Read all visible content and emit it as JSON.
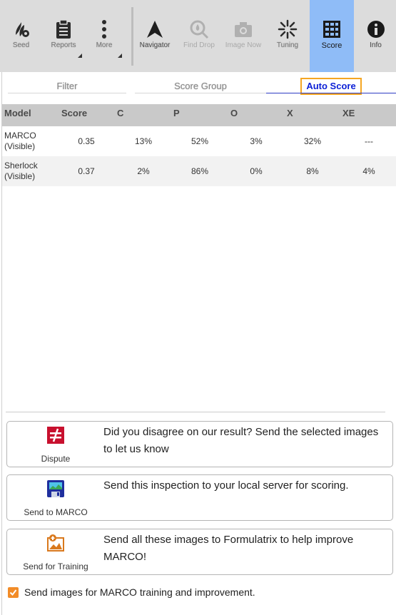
{
  "colors": {
    "toolbar_bg": "#dcdcdc",
    "active_tab": "#8fbcf7",
    "auto_score_text": "#0b1fd6",
    "focus_outline": "#f5a623",
    "table_header": "#c9c9c9",
    "dispute_red": "#c8102e",
    "checkbox_orange": "#f28c28"
  },
  "toolbar": {
    "buttons": [
      {
        "label": "Seed",
        "icon": "seed-icon"
      },
      {
        "label": "Reports",
        "icon": "clipboard-icon",
        "has_menu": true
      },
      {
        "label": "More",
        "icon": "vertical-dots-icon",
        "has_menu": true
      },
      {
        "label": "Navigator",
        "icon": "navigator-arrow-icon"
      },
      {
        "label": "Find Drop",
        "icon": "find-drop-icon",
        "disabled": true
      },
      {
        "label": "Image Now",
        "icon": "camera-icon",
        "disabled": true
      },
      {
        "label": "Tuning",
        "icon": "tuning-burst-icon"
      },
      {
        "label": "Score",
        "icon": "score-grid-icon",
        "active": true
      },
      {
        "label": "Info",
        "icon": "info-icon"
      }
    ]
  },
  "tabs": {
    "filter": "Filter",
    "score_group": "Score Group",
    "auto_score": "Auto Score",
    "selected": "Auto Score"
  },
  "table": {
    "headers": [
      "Model",
      "Score",
      "C",
      "P",
      "O",
      "X",
      "XE"
    ],
    "rows": [
      {
        "model": [
          "MARCO",
          "(Visible)"
        ],
        "values": [
          "0.35",
          "13%",
          "52%",
          "3%",
          "32%",
          "---"
        ]
      },
      {
        "model": [
          "Sherlock",
          "(Visible)"
        ],
        "values": [
          "0.37",
          "2%",
          "86%",
          "0%",
          "8%",
          "4%"
        ]
      }
    ]
  },
  "actions": [
    {
      "caption": "Dispute",
      "icon": "dispute-not-equal-icon",
      "description": "Did you disagree on our result? Send the selected images to let us know"
    },
    {
      "caption": "Send to MARCO",
      "icon": "floppy-disk-icon",
      "description": "Send this inspection to your local server for scoring."
    },
    {
      "caption": "Send for Training",
      "icon": "image-upload-icon",
      "description": "Send all these images to Formulatrix to help improve MARCO!"
    }
  ],
  "training_opt_in": {
    "checked": true,
    "label": "Send images for MARCO training and improvement."
  }
}
